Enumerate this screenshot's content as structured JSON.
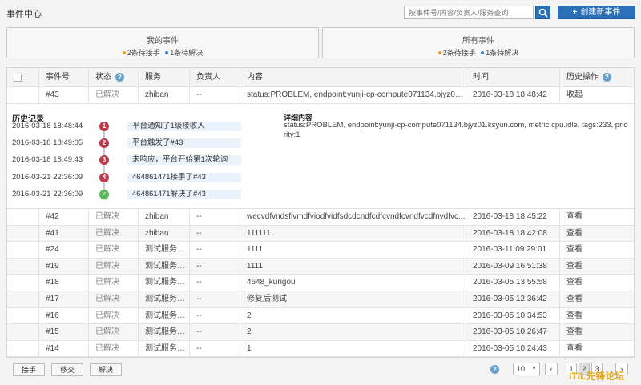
{
  "header": {
    "title": "事件中心",
    "search_placeholder": "按事件号/内容/负责人/服务查询",
    "create_label": "创建新事件"
  },
  "cards": {
    "mine": {
      "title": "我的事件",
      "pending_assign": "2条待接手",
      "pending_resolve": "1条待解决"
    },
    "all": {
      "title": "所有事件",
      "pending_assign": "2条待接手",
      "pending_resolve": "1条待解决"
    }
  },
  "table": {
    "columns": {
      "id": "事件号",
      "status": "状态",
      "service": "服务",
      "owner": "负责人",
      "content": "内容",
      "time": "时间",
      "history": "历史操作"
    },
    "expanded_row": {
      "id": "#43",
      "status": "已解决",
      "service": "zhiban",
      "owner": "--",
      "content": "status:PROBLEM, endpoint:yunji-cp-compute071134.bjyz01.k...",
      "time": "2016-03-18 18:48:42",
      "action": "收起"
    },
    "history": {
      "title": "历史记录",
      "detail_title": "详细内容",
      "detail_text": "status:PROBLEM, endpoint:yunji-cp-compute071134.bjyz01.ksyun.com, metric:cpu.idle, tags:233, priority:1",
      "entries": [
        {
          "time": "2016-03-18 18:48:44",
          "badge": "1",
          "text": "平台通知了1级接收人"
        },
        {
          "time": "2016-03-18 18:49:05",
          "badge": "2",
          "text": "平台触发了#43"
        },
        {
          "time": "2016-03-18 18:49:43",
          "badge": "3",
          "text": "未响应，平台开始第1次轮询"
        },
        {
          "time": "2016-03-21 22:36:09",
          "badge": "4",
          "text": "464861471接手了#43"
        },
        {
          "time": "2016-03-21 22:36:09",
          "badge": "✓",
          "text": "464861471解决了#43"
        }
      ]
    },
    "rows": [
      {
        "id": "#42",
        "status": "已解决",
        "service": "zhiban",
        "owner": "--",
        "content": "wecvdfvndsfivmdfviodfvidfsdcdcndfcdfcvndfcvndfvcdfnvdfvc...",
        "time": "2016-03-18 18:45:22",
        "action": "查看"
      },
      {
        "id": "#41",
        "status": "已解决",
        "service": "zhiban",
        "owner": "--",
        "content": "111111",
        "time": "2016-03-18 18:42:08",
        "action": "查看"
      },
      {
        "id": "#24",
        "status": "已解决",
        "service": "测试服务_升...",
        "owner": "--",
        "content": "1111",
        "time": "2016-03-11 09:29:01",
        "action": "查看"
      },
      {
        "id": "#19",
        "status": "已解决",
        "service": "测试服务_升...",
        "owner": "--",
        "content": "1111",
        "time": "2016-03-09 16:51:38",
        "action": "查看"
      },
      {
        "id": "#18",
        "status": "已解决",
        "service": "测试服务_升...",
        "owner": "--",
        "content": "4648_kungou",
        "time": "2016-03-05 13:55:58",
        "action": "查看"
      },
      {
        "id": "#17",
        "status": "已解决",
        "service": "测试服务_升...",
        "owner": "--",
        "content": "修复后测试",
        "time": "2016-03-05 12:36:42",
        "action": "查看"
      },
      {
        "id": "#16",
        "status": "已解决",
        "service": "测试服务_升...",
        "owner": "--",
        "content": "2",
        "time": "2016-03-05 10:34:53",
        "action": "查看"
      },
      {
        "id": "#15",
        "status": "已解决",
        "service": "测试服务_升...",
        "owner": "--",
        "content": "2",
        "time": "2016-03-05 10:26:47",
        "action": "查看"
      },
      {
        "id": "#14",
        "status": "已解决",
        "service": "测试服务_升...",
        "owner": "--",
        "content": "1",
        "time": "2016-03-05 10:24:43",
        "action": "查看"
      }
    ]
  },
  "footer": {
    "assign_label": "接手",
    "transfer_label": "移交",
    "resolve_label": "解决",
    "page_size": "10",
    "pages": [
      "1",
      "2",
      "3"
    ],
    "current_page": "2",
    "prev": "‹",
    "next": "›"
  },
  "watermark": "ITIL先锋论坛"
}
